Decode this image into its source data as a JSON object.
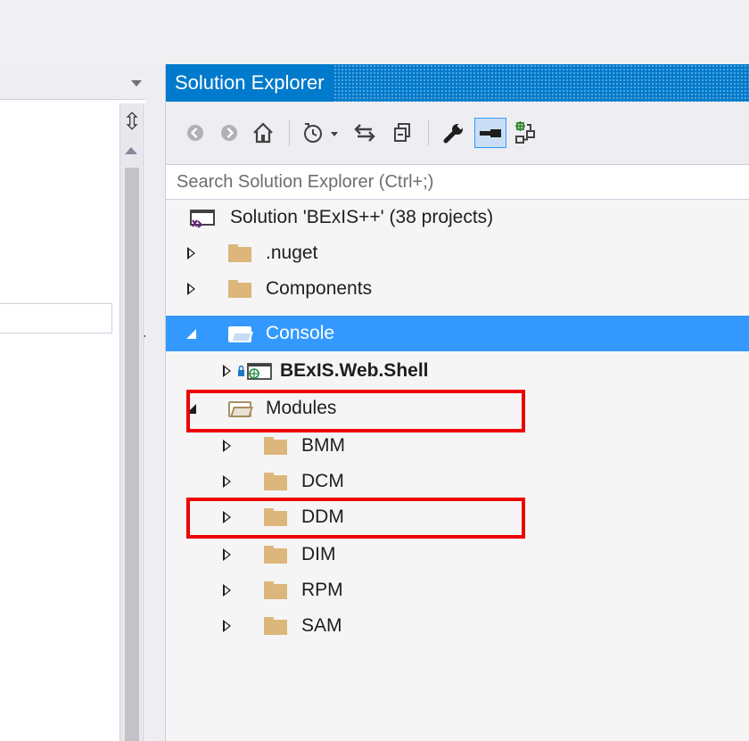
{
  "explorer": {
    "title": "Solution Explorer",
    "search_placeholder": "Search Solution Explorer (Ctrl+;)"
  },
  "toolbar": {
    "buttons": [
      {
        "icon": "back-icon"
      },
      {
        "icon": "forward-icon"
      },
      {
        "icon": "home-icon"
      },
      {
        "icon": "pending-changes-filter-icon"
      },
      {
        "icon": "sync-icon"
      },
      {
        "icon": "collapse-all-icon"
      },
      {
        "icon": "properties-wrench-icon"
      },
      {
        "icon": "preview-selected-icon"
      },
      {
        "icon": "class-view-icon"
      }
    ]
  },
  "tree": {
    "solution": "Solution 'BExIS++' (38 projects)",
    "items": [
      {
        "label": ".nuget",
        "state": "collapsed",
        "depth": 1
      },
      {
        "label": "Components",
        "state": "collapsed",
        "depth": 1
      },
      {
        "label": "Console",
        "state": "expanded",
        "depth": 1,
        "selected": true
      },
      {
        "label": "BExIS.Web.Shell",
        "state": "collapsed",
        "depth": 2,
        "bold": true
      },
      {
        "label": "Modules",
        "state": "expanded",
        "depth": 1,
        "highlighted": true
      },
      {
        "label": "BMM",
        "state": "collapsed",
        "depth": 2
      },
      {
        "label": "DCM",
        "state": "collapsed",
        "depth": 2
      },
      {
        "label": "DDM",
        "state": "collapsed",
        "depth": 2,
        "highlighted": true
      },
      {
        "label": "DIM",
        "state": "collapsed",
        "depth": 2
      },
      {
        "label": "RPM",
        "state": "collapsed",
        "depth": 2
      },
      {
        "label": "SAM",
        "state": "collapsed",
        "depth": 2
      }
    ]
  },
  "colors": {
    "accent": "#007acc",
    "selection": "#3399ff",
    "highlight_box": "#ee0000",
    "folder": "#dcb67a"
  }
}
